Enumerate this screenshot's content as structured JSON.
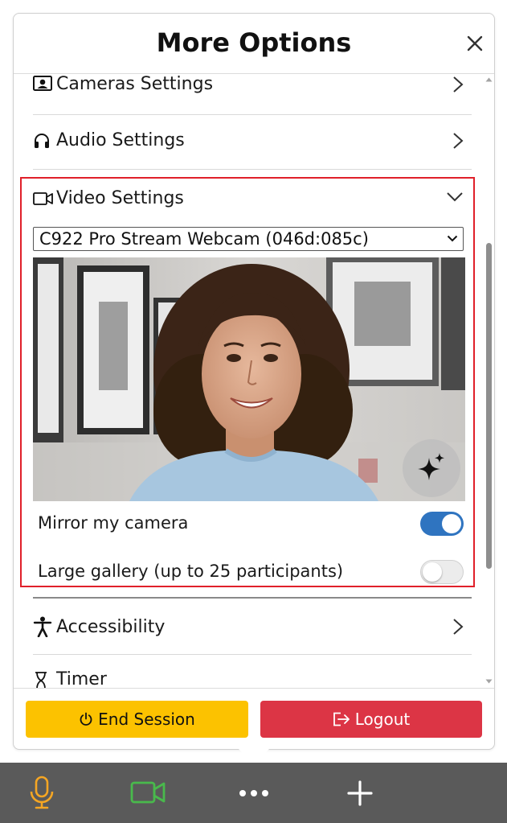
{
  "panel": {
    "title": "More Options"
  },
  "menu": {
    "cameras_settings": "Cameras Settings",
    "audio_settings": "Audio Settings",
    "video_settings": "Video Settings",
    "accessibility": "Accessibility",
    "timer": "Timer"
  },
  "video": {
    "camera_select_value": "C922 Pro Stream Webcam (046d:085c)",
    "mirror_label": "Mirror my camera",
    "mirror_on": true,
    "large_gallery_label": "Large gallery (up to 25 participants)",
    "large_gallery_on": false
  },
  "footer": {
    "end_session": "End Session",
    "logout": "Logout"
  },
  "colors": {
    "highlight_border": "#e0202a",
    "end_session_bg": "#fcc200",
    "logout_bg": "#dc3545",
    "toggle_on": "#2f74c0",
    "mic_icon": "#f5a623",
    "camera_icon": "#49b94c",
    "bottom_bar_bg": "#5a5a5a"
  },
  "icons": {
    "close": "close-icon",
    "cameras": "portrait-card-icon",
    "audio": "headphones-icon",
    "video": "video-camera-icon",
    "accessibility": "person-accessibility-icon",
    "timer": "hourglass-icon",
    "effects": "sparkles-icon",
    "end_session": "power-icon",
    "logout": "logout-icon",
    "mic": "microphone-icon",
    "camera_toggle": "camera-icon",
    "more": "more-dots-icon",
    "add": "plus-icon"
  }
}
